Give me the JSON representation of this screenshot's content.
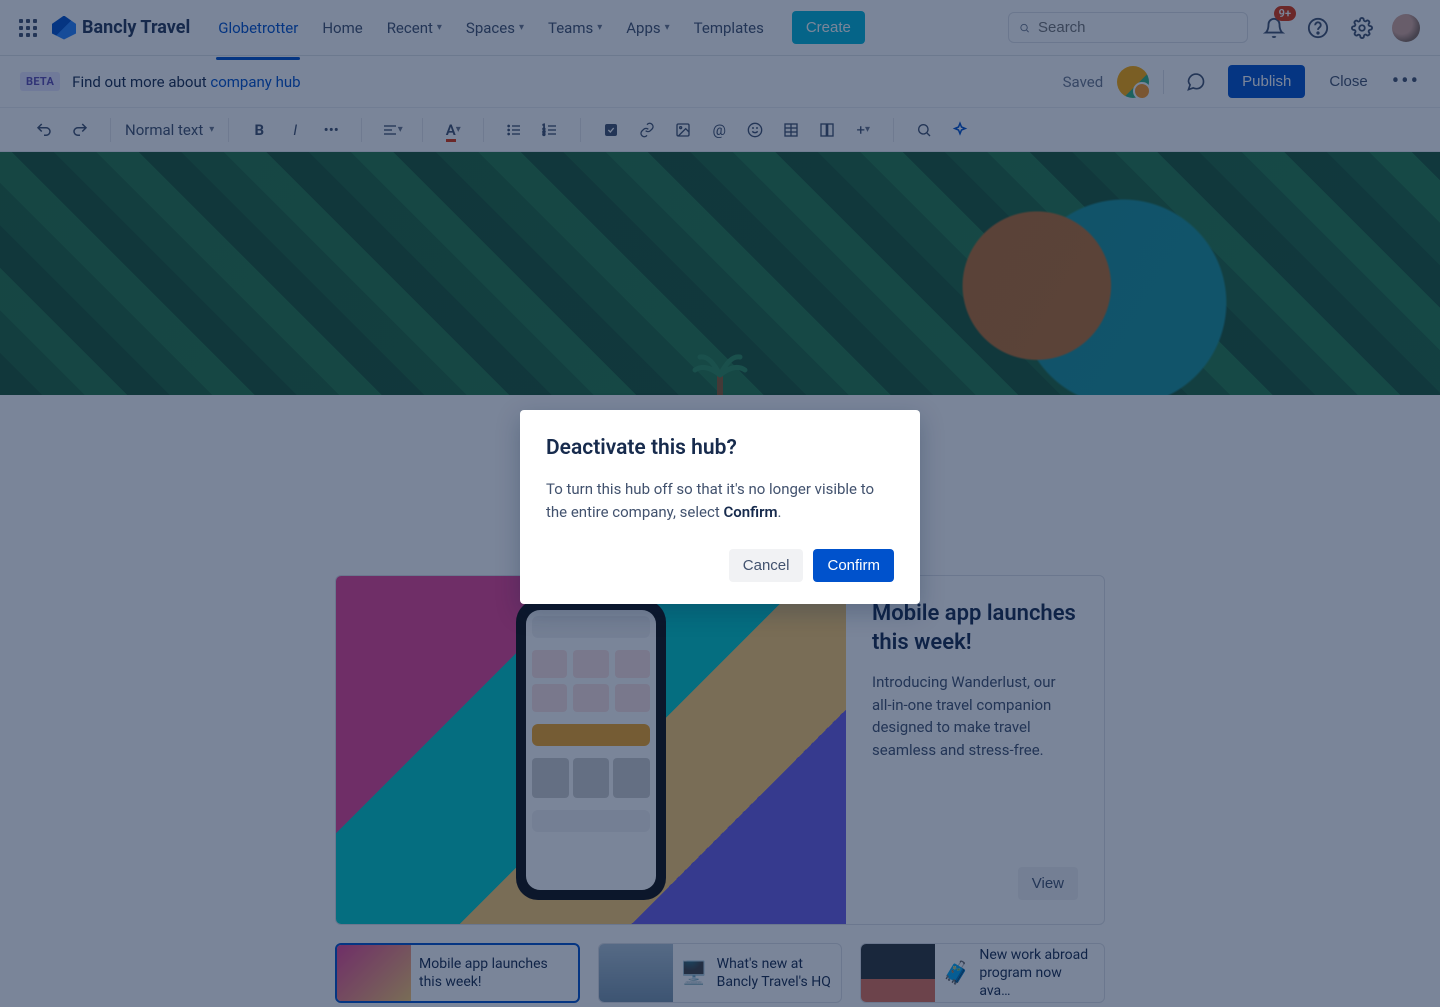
{
  "header": {
    "brand": "Bancly Travel",
    "nav": {
      "globetrotter": "Globetrotter",
      "home": "Home",
      "recent": "Recent",
      "spaces": "Spaces",
      "teams": "Teams",
      "apps": "Apps",
      "templates": "Templates"
    },
    "create": "Create",
    "search_placeholder": "Search",
    "notification_badge": "9+"
  },
  "banner": {
    "beta": "BETA",
    "text_prefix": "Find out more about ",
    "link": "company hub",
    "saved": "Saved",
    "publish": "Publish",
    "close": "Close"
  },
  "toolbar": {
    "text_style": "Normal text"
  },
  "featured": {
    "title": "Mobile app launches this week!",
    "desc": "Introducing Wanderlust, our all-in-one travel companion designed to make travel seamless and stress-free.",
    "view": "View"
  },
  "cards": [
    {
      "emoji": "",
      "label": "Mobile app launches this week!"
    },
    {
      "emoji": "🖥️",
      "label": "What's new at Bancly Travel's HQ"
    },
    {
      "emoji": "🧳",
      "label": "New work abroad program now ava…"
    }
  ],
  "modal": {
    "title": "Deactivate this hub?",
    "body_prefix": "To turn this hub off so that it's no longer visible to the entire company, select ",
    "body_bold": "Confirm",
    "body_suffix": ".",
    "cancel": "Cancel",
    "confirm": "Confirm"
  }
}
